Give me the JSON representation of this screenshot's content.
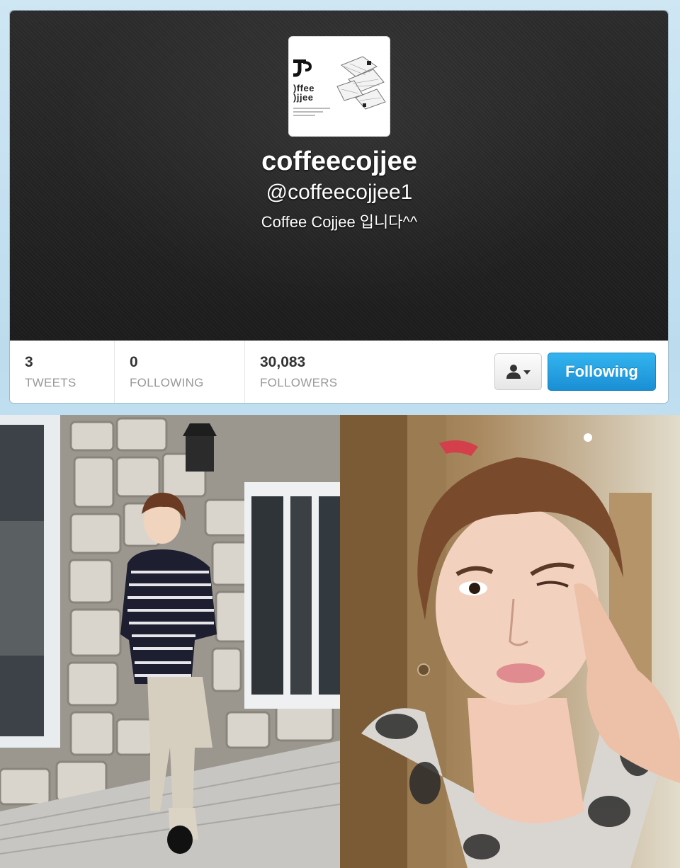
{
  "profile": {
    "display_name": "coffeecojjee",
    "handle": "@coffeecojjee1",
    "bio": "Coffee Cojjee 입니다^^",
    "avatar_logo_text": "coffee\ncojjee"
  },
  "stats": [
    {
      "value": "3",
      "label": "TWEETS"
    },
    {
      "value": "0",
      "label": "FOLLOWING"
    },
    {
      "value": "30,083",
      "label": "FOLLOWERS"
    }
  ],
  "actions": {
    "follow_label": "Following",
    "user_menu_icon": "person-dropdown-icon"
  },
  "colors": {
    "follow_button": "#2a9fe0",
    "header_bg": "#222222"
  }
}
